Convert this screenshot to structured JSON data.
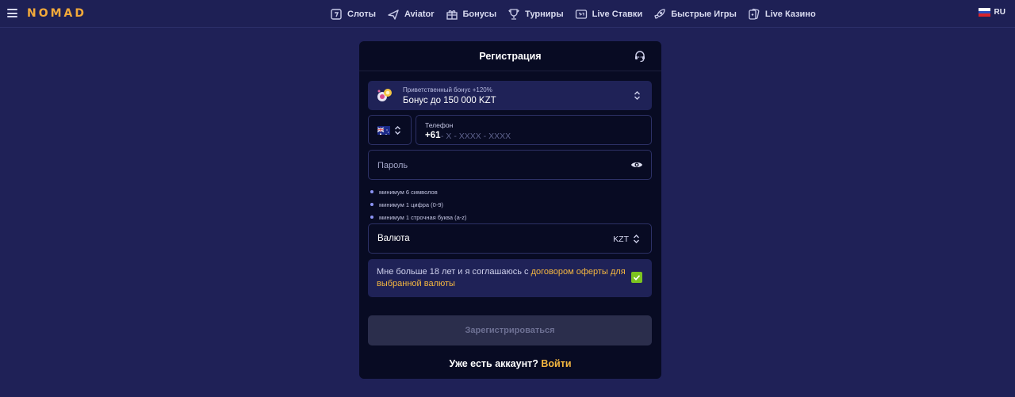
{
  "header": {
    "logo": "NOMAD",
    "nav": [
      {
        "icon": "slots-icon",
        "label": "Слоты"
      },
      {
        "icon": "plane-icon",
        "label": "Aviator"
      },
      {
        "icon": "gift-icon",
        "label": "Бонусы"
      },
      {
        "icon": "trophy-icon",
        "label": "Турниры"
      },
      {
        "icon": "live-bets-icon",
        "label": "Live Ставки"
      },
      {
        "icon": "rocket-icon",
        "label": "Быстрые Игры"
      },
      {
        "icon": "cards-icon",
        "label": "Live Казино"
      }
    ],
    "language": "RU"
  },
  "form": {
    "title": "Регистрация",
    "bonus": {
      "subtitle": "Приветственный бонус +120%",
      "value": "Бонус до 150 000 KZT"
    },
    "phone": {
      "label": "Телефон",
      "code": "+61",
      "mask": "- X - XXXX - XXXX"
    },
    "password": {
      "placeholder": "Пароль"
    },
    "rules": [
      "минимум 6 символов",
      "минимум 1 цифра (0-9)",
      "минимум 1 строчная буква (a-z)"
    ],
    "currency": {
      "label": "Валюта",
      "value": "KZT"
    },
    "consent": {
      "text": "Мне больше 18 лет и я соглашаюсь с ",
      "link": "договором оферты для выбранной валюты"
    },
    "submit": "Зарегистрироваться",
    "login": {
      "question": "Уже есть аккаунт?",
      "link": "Войти"
    }
  },
  "colors": {
    "page_bg": "#1f2157",
    "card_bg": "#080b23",
    "accent": "#f5b740",
    "check": "#7cc41f"
  }
}
